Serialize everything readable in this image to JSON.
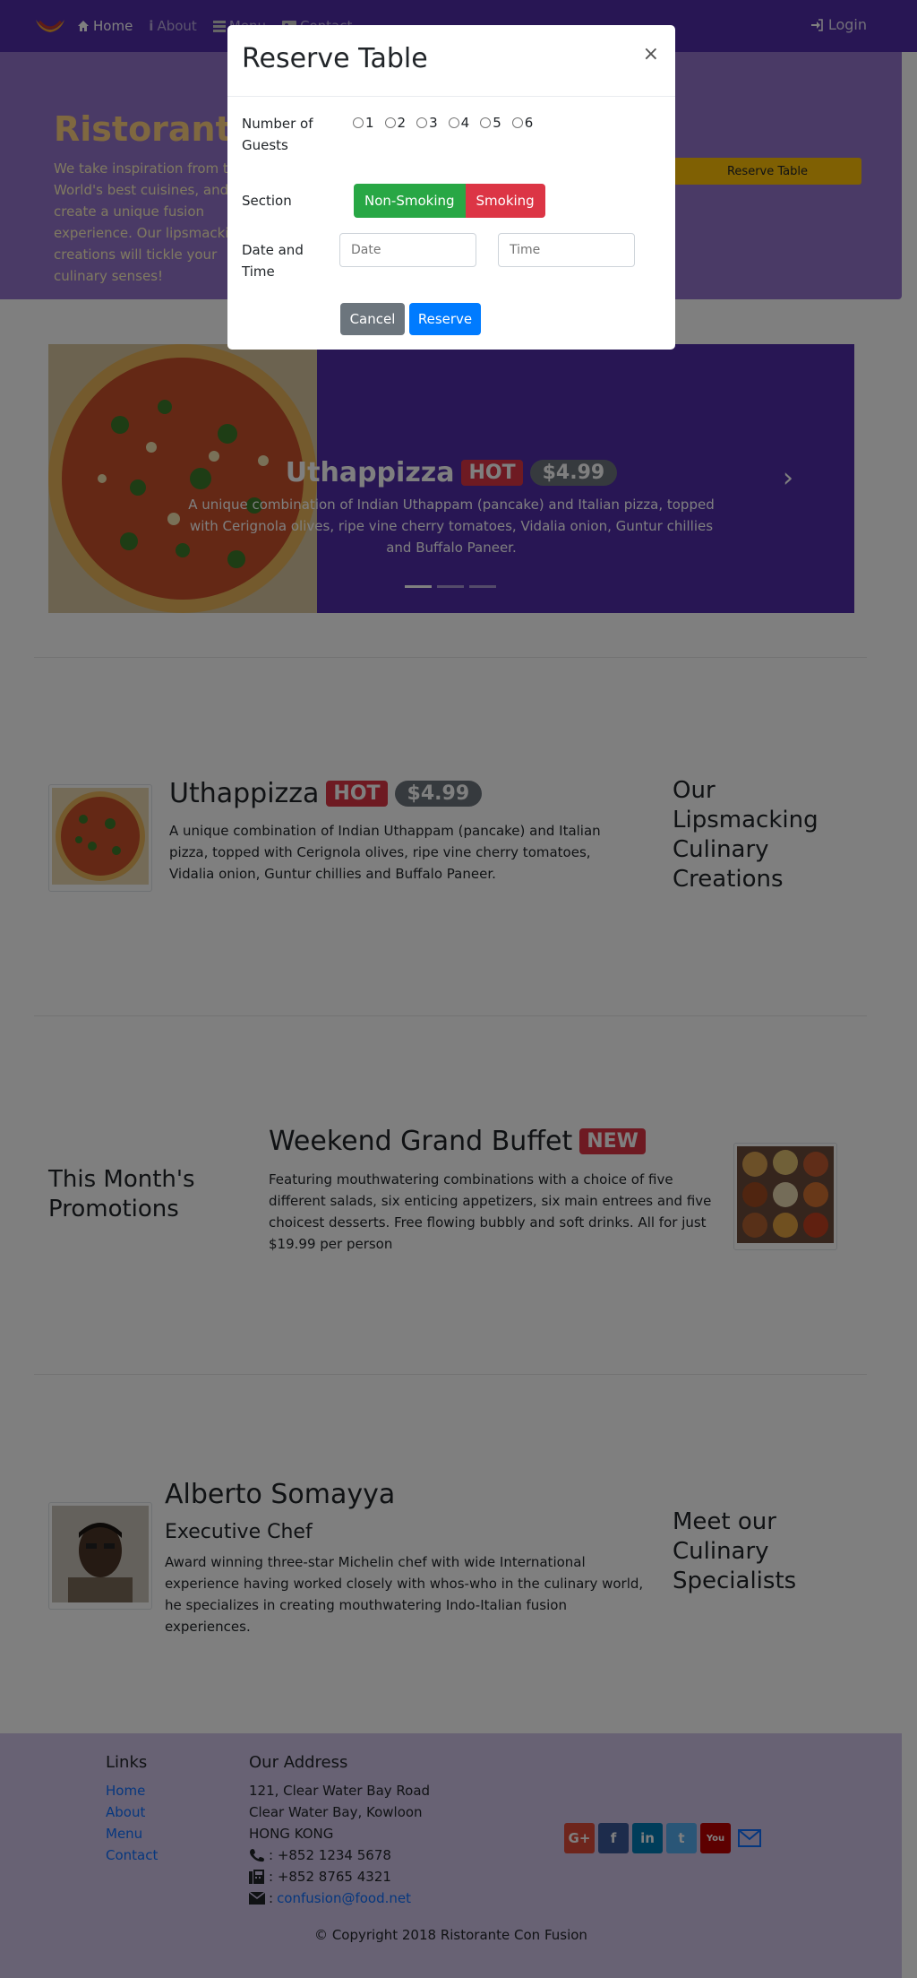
{
  "nav": {
    "items": [
      {
        "label": "Home",
        "icon": "home-icon"
      },
      {
        "label": "About",
        "icon": "info-icon"
      },
      {
        "label": "Menu",
        "icon": "list-icon"
      },
      {
        "label": "Contact",
        "icon": "address-card-icon"
      }
    ],
    "login": "Login"
  },
  "jumbotron": {
    "title": "Ristorante",
    "text": "We take inspiration from the World's best cuisines, and create a unique fusion experience. Our lipsmacking creations will tickle your culinary senses!",
    "reserve_button": "Reserve Table"
  },
  "carousel": {
    "title": "Uthappizza",
    "badge": "HOT",
    "price": "$4.99",
    "description": "A unique combination of Indian Uthappam (pancake) and Italian pizza, topped with Cerignola olives, ripe vine cherry tomatoes, Vidalia onion, Guntur chillies and Buffalo Paneer."
  },
  "dish": {
    "title": "Uthappizza",
    "badge": "HOT",
    "price": "$4.99",
    "description": "A unique combination of Indian Uthappam (pancake) and Italian pizza, topped with Cerignola olives, ripe vine cherry tomatoes, Vidalia onion, Guntur chillies and Buffalo Paneer.",
    "side_heading": "Our Lipsmacking Culinary Creations"
  },
  "promotion": {
    "side_heading": "This Month's Promotions",
    "title": "Weekend Grand Buffet",
    "badge": "NEW",
    "description": "Featuring mouthwatering combinations with a choice of five different salads, six enticing appetizers, six main entrees and five choicest desserts. Free flowing bubbly and soft drinks. All for just $19.99 per person"
  },
  "leader": {
    "name": "Alberto Somayya",
    "role": "Executive Chef",
    "description": "Award winning three-star Michelin chef with wide International experience having worked closely with whos-who in the culinary world, he specializes in creating mouthwatering Indo-Italian fusion experiences.",
    "side_heading": "Meet our Culinary Specialists"
  },
  "footer": {
    "links_heading": "Links",
    "links": [
      "Home",
      "About",
      "Menu",
      "Contact"
    ],
    "address_heading": "Our Address",
    "address_lines": [
      "121, Clear Water Bay Road",
      "Clear Water Bay, Kowloon",
      "HONG KONG"
    ],
    "phone": ": +852 1234 5678",
    "fax": ": +852 8765 4321",
    "email_prefix": ":",
    "email": "confusion@food.net",
    "copyright": "© Copyright 2018 Ristorante Con Fusion"
  },
  "modal": {
    "title": "Reserve Table",
    "close": "×",
    "guests_label": "Number of Guests",
    "guest_options": [
      "1",
      "2",
      "3",
      "4",
      "5",
      "6"
    ],
    "section_label": "Section",
    "section_options": [
      "Non-Smoking",
      "Smoking"
    ],
    "datetime_label": "Date and Time",
    "date_placeholder": "Date",
    "time_placeholder": "Time",
    "cancel": "Cancel",
    "reserve": "Reserve"
  },
  "colors": {
    "primary": "#512da8",
    "jumbotron": "#9575cd",
    "footer": "#d1c4e9",
    "warning": "#ffc107",
    "danger": "#dc3545",
    "success": "#28a745",
    "info": "#007bff"
  }
}
